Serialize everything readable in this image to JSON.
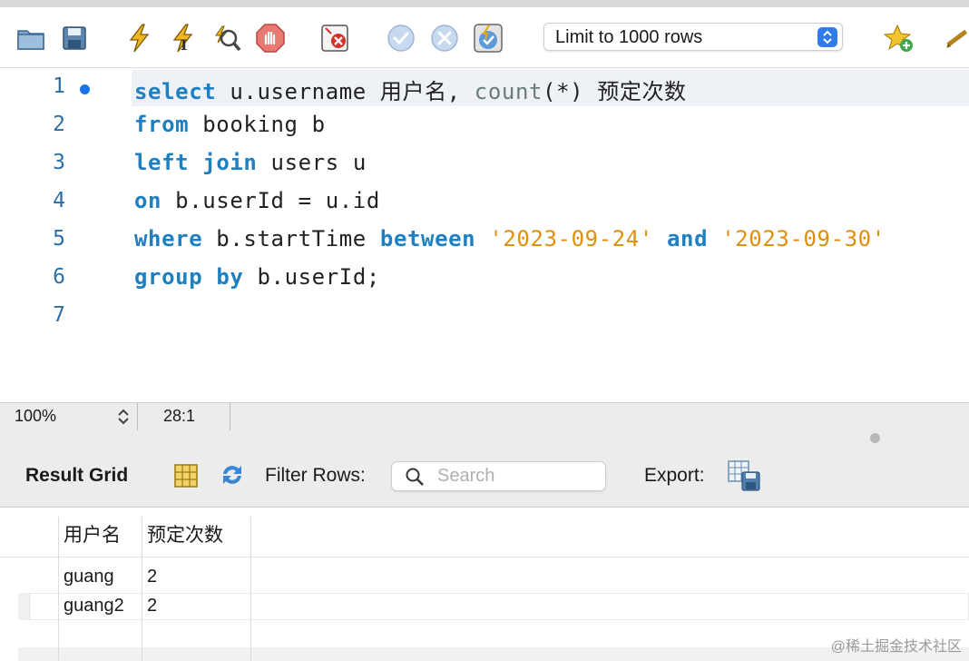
{
  "toolbar": {
    "icons": [
      "open-folder-icon",
      "save-icon",
      "execute-icon",
      "execute-current-icon",
      "explain-icon",
      "stop-icon",
      "toggle-error-stop-icon",
      "commit-icon",
      "rollback-icon",
      "autocommit-icon",
      "beautify-star-icon",
      "beautify-icon"
    ],
    "limit_label": "Limit to 1000 rows"
  },
  "editor": {
    "lines": [
      {
        "number": "1",
        "tokens": [
          {
            "t": "select",
            "c": "kw"
          },
          {
            "t": " u.username 用户名, ",
            "c": ""
          },
          {
            "t": "count",
            "c": "fn"
          },
          {
            "t": "(*) 预定次数",
            "c": ""
          }
        ]
      },
      {
        "number": "2",
        "tokens": [
          {
            "t": "from",
            "c": "kw"
          },
          {
            "t": " booking b",
            "c": ""
          }
        ]
      },
      {
        "number": "3",
        "tokens": [
          {
            "t": "left",
            "c": "kw"
          },
          {
            "t": " ",
            "c": ""
          },
          {
            "t": "join",
            "c": "kw"
          },
          {
            "t": " users u",
            "c": ""
          }
        ]
      },
      {
        "number": "4",
        "tokens": [
          {
            "t": "on",
            "c": "kw"
          },
          {
            "t": " b.userId = u.id",
            "c": ""
          }
        ]
      },
      {
        "number": "5",
        "tokens": [
          {
            "t": "where",
            "c": "kw"
          },
          {
            "t": " b.startTime ",
            "c": ""
          },
          {
            "t": "between",
            "c": "kw"
          },
          {
            "t": " ",
            "c": ""
          },
          {
            "t": "'2023-09-24'",
            "c": "str"
          },
          {
            "t": " ",
            "c": ""
          },
          {
            "t": "and",
            "c": "kw"
          },
          {
            "t": " ",
            "c": ""
          },
          {
            "t": "'2023-09-30'",
            "c": "str"
          }
        ]
      },
      {
        "number": "6",
        "tokens": [
          {
            "t": "group",
            "c": "kw"
          },
          {
            "t": " ",
            "c": ""
          },
          {
            "t": "by",
            "c": "kw"
          },
          {
            "t": " b.userId;",
            "c": ""
          }
        ]
      },
      {
        "number": "7",
        "tokens": []
      }
    ]
  },
  "status": {
    "zoom": "100%",
    "cursor": "28:1"
  },
  "result": {
    "title": "Result Grid",
    "filter_label": "Filter Rows:",
    "search_placeholder": "Search",
    "export_label": "Export:",
    "columns": [
      "用户名",
      "预定次数"
    ],
    "rows": [
      [
        "guang",
        "2"
      ],
      [
        "guang2",
        "2"
      ]
    ]
  },
  "watermark": "@稀土掘金技术社区"
}
